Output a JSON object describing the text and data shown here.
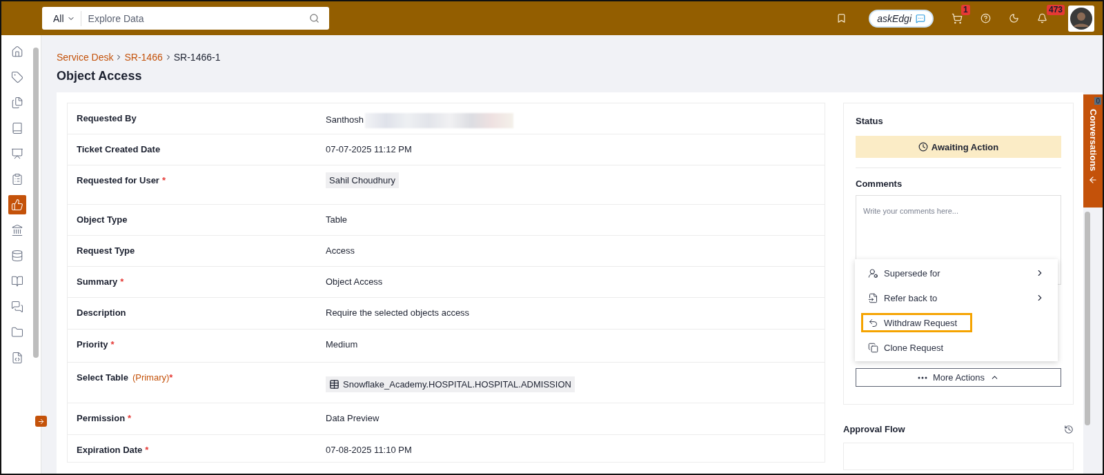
{
  "topbar": {
    "scope": "All",
    "search_placeholder": "Explore Data",
    "ask_label": "askEdgi",
    "cart_count": "1",
    "notification_count": "473"
  },
  "sidebar": {
    "items": [
      {
        "kind": "home",
        "selected": false
      },
      {
        "kind": "tag",
        "selected": false
      },
      {
        "kind": "files",
        "selected": false
      },
      {
        "kind": "book",
        "selected": false
      },
      {
        "kind": "dashboard",
        "selected": false
      },
      {
        "kind": "clipboard",
        "selected": false
      },
      {
        "kind": "request",
        "selected": true
      },
      {
        "kind": "bank",
        "selected": false
      },
      {
        "kind": "database",
        "selected": false
      },
      {
        "kind": "guide",
        "selected": false
      },
      {
        "kind": "chat",
        "selected": false
      },
      {
        "kind": "folder",
        "selected": false
      },
      {
        "kind": "code",
        "selected": false
      }
    ]
  },
  "breadcrumb": [
    {
      "label": "Service Desk",
      "link": true
    },
    {
      "label": "SR-1466",
      "link": true
    },
    {
      "label": "SR-1466-1",
      "link": false
    }
  ],
  "title": "Object Access",
  "fields": [
    {
      "label": "Requested By",
      "value": "Santhosh",
      "kind": "redacted"
    },
    {
      "label": "Ticket Created Date",
      "value": "07-07-2025 11:12 PM",
      "kind": "text"
    },
    {
      "label": "Requested for User",
      "required_mark": "*",
      "value": "Sahil Choudhury",
      "kind": "chip"
    },
    {
      "label": "Object Type",
      "value": "Table",
      "kind": "text"
    },
    {
      "label": "Request Type",
      "value": "Access",
      "kind": "text"
    },
    {
      "label": "Summary",
      "required_mark": "*",
      "value": "Object Access",
      "kind": "text"
    },
    {
      "label": "Description",
      "value": "Require the selected objects access",
      "kind": "text"
    },
    {
      "label": "Priority",
      "required_mark": "*",
      "value": "Medium",
      "kind": "text"
    },
    {
      "label": "Select Table",
      "note": "(Primary)",
      "required_mark": "*",
      "value": "Snowflake_Academy.HOSPITAL.HOSPITAL.ADMISSION",
      "kind": "table"
    },
    {
      "label": "Permission",
      "required_mark": "*",
      "value": "Data Preview",
      "kind": "text"
    },
    {
      "label": "Expiration Date",
      "required_mark": "*",
      "value": "07-08-2025 11:10 PM",
      "kind": "text"
    }
  ],
  "status": {
    "heading": "Status",
    "value": "Awaiting Action"
  },
  "comments": {
    "heading": "Comments",
    "placeholder": "Write your comments here..."
  },
  "menu": [
    {
      "label": "Supersede for",
      "kind": "supersede",
      "submenu": true,
      "highlighted": false
    },
    {
      "label": "Refer back to",
      "kind": "refer",
      "submenu": true,
      "highlighted": false
    },
    {
      "label": "Withdraw Request",
      "kind": "withdraw",
      "submenu": false,
      "highlighted": true
    },
    {
      "label": "Clone Request",
      "kind": "clone",
      "submenu": false,
      "highlighted": false
    }
  ],
  "more_actions": {
    "label": "More Actions",
    "expanded": true
  },
  "approval_flow": {
    "heading": "Approval Flow"
  },
  "conversations": {
    "label": "Conversations",
    "count": "0"
  }
}
